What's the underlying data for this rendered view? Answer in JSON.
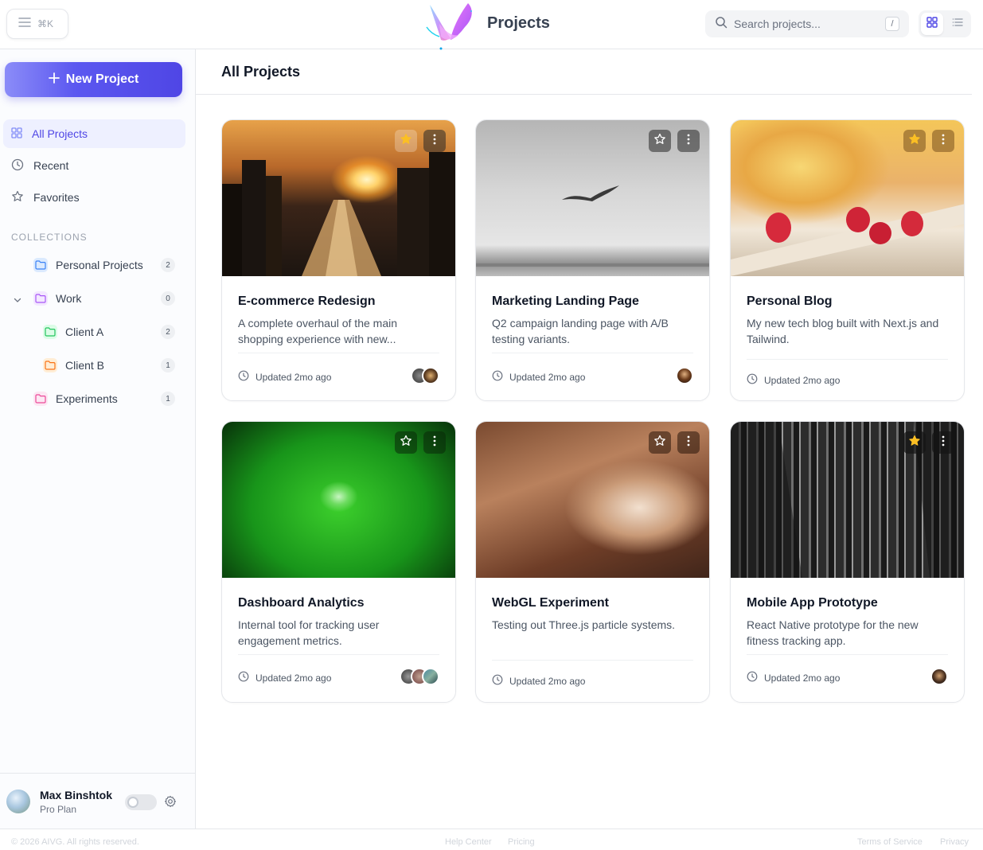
{
  "header": {
    "shortcut": "⌘K",
    "title": "Projects",
    "search_placeholder": "Search projects...",
    "search_shortcut": "/"
  },
  "sidebar": {
    "new_project_label": "New Project",
    "nav": [
      {
        "label": "All Projects",
        "icon": "grid-icon",
        "active": true
      },
      {
        "label": "Recent",
        "icon": "clock-icon",
        "active": false
      },
      {
        "label": "Favorites",
        "icon": "star-icon",
        "active": false
      }
    ],
    "collections_label": "COLLECTIONS",
    "collections": [
      {
        "label": "Personal Projects",
        "count": "2",
        "color": "#3b82f6"
      },
      {
        "label": "Work",
        "count": "0",
        "color": "#a855f7"
      },
      {
        "label": "Client A",
        "count": "2",
        "color": "#22c55e"
      },
      {
        "label": "Client B",
        "count": "1",
        "color": "#f97316"
      },
      {
        "label": "Experiments",
        "count": "1",
        "color": "#ec4899"
      }
    ],
    "user": {
      "name": "Max Binshtok",
      "plan": "Pro Plan"
    }
  },
  "main": {
    "title": "All Projects",
    "cards": [
      {
        "title": "E-commerce Redesign",
        "desc": "A complete overhaul of the main shopping experience with new...",
        "updated": "Updated 2mo ago",
        "favorite": true
      },
      {
        "title": "Marketing Landing Page",
        "desc": "Q2 campaign landing page with A/B testing variants.",
        "updated": "Updated 2mo ago",
        "favorite": false
      },
      {
        "title": "Personal Blog",
        "desc": "My new tech blog built with Next.js and Tailwind.",
        "updated": "Updated 2mo ago",
        "favorite": true
      },
      {
        "title": "Dashboard Analytics",
        "desc": "Internal tool for tracking user engagement metrics.",
        "updated": "Updated 2mo ago",
        "favorite": false
      },
      {
        "title": "WebGL Experiment",
        "desc": "Testing out Three.js particle systems.",
        "updated": "Updated 2mo ago",
        "favorite": false
      },
      {
        "title": "Mobile App Prototype",
        "desc": "React Native prototype for the new fitness tracking app.",
        "updated": "Updated 2mo ago",
        "favorite": true
      }
    ]
  },
  "footer": {
    "copyright": "© 2026 AIVG. All rights reserved.",
    "help": "Help Center",
    "pricing": "Pricing",
    "terms": "Terms of Service",
    "privacy": "Privacy"
  },
  "colors": {
    "accent": "#4f46e5",
    "star": "#fbbf24"
  }
}
